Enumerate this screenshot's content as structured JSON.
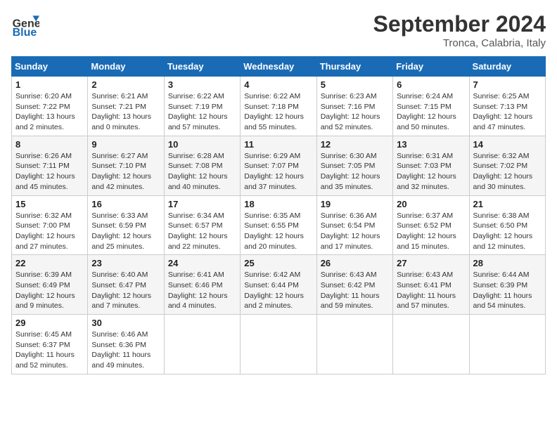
{
  "header": {
    "logo_general": "General",
    "logo_blue": "Blue",
    "month_title": "September 2024",
    "subtitle": "Tronca, Calabria, Italy"
  },
  "calendar": {
    "days_of_week": [
      "Sunday",
      "Monday",
      "Tuesday",
      "Wednesday",
      "Thursday",
      "Friday",
      "Saturday"
    ],
    "weeks": [
      [
        {
          "day": "1",
          "info": "Sunrise: 6:20 AM\nSunset: 7:22 PM\nDaylight: 13 hours\nand 2 minutes."
        },
        {
          "day": "2",
          "info": "Sunrise: 6:21 AM\nSunset: 7:21 PM\nDaylight: 13 hours\nand 0 minutes."
        },
        {
          "day": "3",
          "info": "Sunrise: 6:22 AM\nSunset: 7:19 PM\nDaylight: 12 hours\nand 57 minutes."
        },
        {
          "day": "4",
          "info": "Sunrise: 6:22 AM\nSunset: 7:18 PM\nDaylight: 12 hours\nand 55 minutes."
        },
        {
          "day": "5",
          "info": "Sunrise: 6:23 AM\nSunset: 7:16 PM\nDaylight: 12 hours\nand 52 minutes."
        },
        {
          "day": "6",
          "info": "Sunrise: 6:24 AM\nSunset: 7:15 PM\nDaylight: 12 hours\nand 50 minutes."
        },
        {
          "day": "7",
          "info": "Sunrise: 6:25 AM\nSunset: 7:13 PM\nDaylight: 12 hours\nand 47 minutes."
        }
      ],
      [
        {
          "day": "8",
          "info": "Sunrise: 6:26 AM\nSunset: 7:11 PM\nDaylight: 12 hours\nand 45 minutes."
        },
        {
          "day": "9",
          "info": "Sunrise: 6:27 AM\nSunset: 7:10 PM\nDaylight: 12 hours\nand 42 minutes."
        },
        {
          "day": "10",
          "info": "Sunrise: 6:28 AM\nSunset: 7:08 PM\nDaylight: 12 hours\nand 40 minutes."
        },
        {
          "day": "11",
          "info": "Sunrise: 6:29 AM\nSunset: 7:07 PM\nDaylight: 12 hours\nand 37 minutes."
        },
        {
          "day": "12",
          "info": "Sunrise: 6:30 AM\nSunset: 7:05 PM\nDaylight: 12 hours\nand 35 minutes."
        },
        {
          "day": "13",
          "info": "Sunrise: 6:31 AM\nSunset: 7:03 PM\nDaylight: 12 hours\nand 32 minutes."
        },
        {
          "day": "14",
          "info": "Sunrise: 6:32 AM\nSunset: 7:02 PM\nDaylight: 12 hours\nand 30 minutes."
        }
      ],
      [
        {
          "day": "15",
          "info": "Sunrise: 6:32 AM\nSunset: 7:00 PM\nDaylight: 12 hours\nand 27 minutes."
        },
        {
          "day": "16",
          "info": "Sunrise: 6:33 AM\nSunset: 6:59 PM\nDaylight: 12 hours\nand 25 minutes."
        },
        {
          "day": "17",
          "info": "Sunrise: 6:34 AM\nSunset: 6:57 PM\nDaylight: 12 hours\nand 22 minutes."
        },
        {
          "day": "18",
          "info": "Sunrise: 6:35 AM\nSunset: 6:55 PM\nDaylight: 12 hours\nand 20 minutes."
        },
        {
          "day": "19",
          "info": "Sunrise: 6:36 AM\nSunset: 6:54 PM\nDaylight: 12 hours\nand 17 minutes."
        },
        {
          "day": "20",
          "info": "Sunrise: 6:37 AM\nSunset: 6:52 PM\nDaylight: 12 hours\nand 15 minutes."
        },
        {
          "day": "21",
          "info": "Sunrise: 6:38 AM\nSunset: 6:50 PM\nDaylight: 12 hours\nand 12 minutes."
        }
      ],
      [
        {
          "day": "22",
          "info": "Sunrise: 6:39 AM\nSunset: 6:49 PM\nDaylight: 12 hours\nand 9 minutes."
        },
        {
          "day": "23",
          "info": "Sunrise: 6:40 AM\nSunset: 6:47 PM\nDaylight: 12 hours\nand 7 minutes."
        },
        {
          "day": "24",
          "info": "Sunrise: 6:41 AM\nSunset: 6:46 PM\nDaylight: 12 hours\nand 4 minutes."
        },
        {
          "day": "25",
          "info": "Sunrise: 6:42 AM\nSunset: 6:44 PM\nDaylight: 12 hours\nand 2 minutes."
        },
        {
          "day": "26",
          "info": "Sunrise: 6:43 AM\nSunset: 6:42 PM\nDaylight: 11 hours\nand 59 minutes."
        },
        {
          "day": "27",
          "info": "Sunrise: 6:43 AM\nSunset: 6:41 PM\nDaylight: 11 hours\nand 57 minutes."
        },
        {
          "day": "28",
          "info": "Sunrise: 6:44 AM\nSunset: 6:39 PM\nDaylight: 11 hours\nand 54 minutes."
        }
      ],
      [
        {
          "day": "29",
          "info": "Sunrise: 6:45 AM\nSunset: 6:37 PM\nDaylight: 11 hours\nand 52 minutes."
        },
        {
          "day": "30",
          "info": "Sunrise: 6:46 AM\nSunset: 6:36 PM\nDaylight: 11 hours\nand 49 minutes."
        },
        {
          "day": "",
          "info": ""
        },
        {
          "day": "",
          "info": ""
        },
        {
          "day": "",
          "info": ""
        },
        {
          "day": "",
          "info": ""
        },
        {
          "day": "",
          "info": ""
        }
      ]
    ]
  }
}
